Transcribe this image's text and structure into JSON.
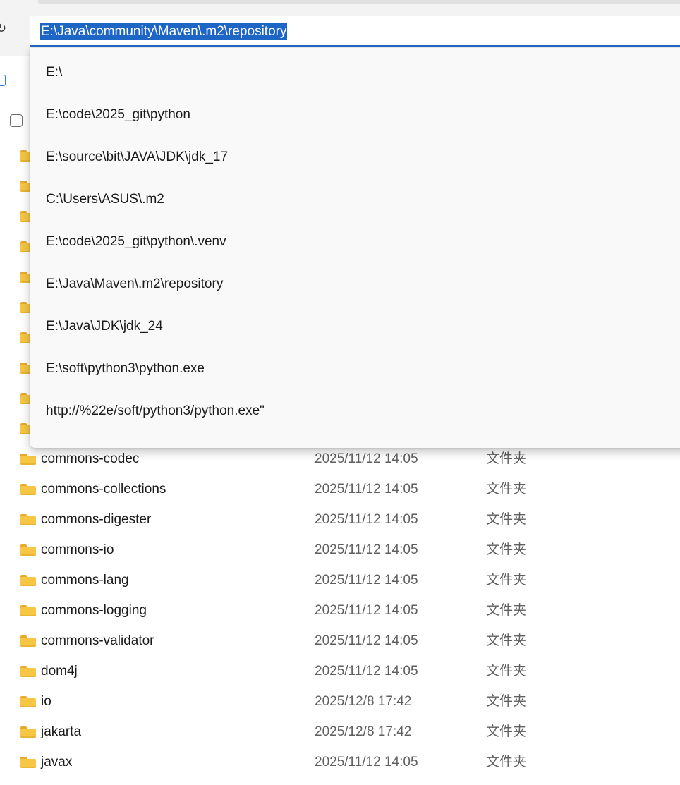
{
  "address_bar": {
    "value": "E:\\Java\\community\\Maven\\.m2\\repository"
  },
  "address_history": [
    "E:\\",
    "E:\\code\\2025_git\\python",
    "E:\\source\\bit\\JAVA\\JDK\\jdk_17",
    "C:\\Users\\ASUS\\.m2",
    "E:\\code\\2025_git\\python\\.venv",
    "E:\\Java\\Maven\\.m2\\repository",
    "E:\\Java\\JDK\\jdk_24",
    "E:\\soft\\python3\\python.exe",
    "http://%22e/soft/python3/python.exe\""
  ],
  "files": [
    {
      "name": "commons-codec",
      "date": "2025/11/12 14:05",
      "type": "文件夹"
    },
    {
      "name": "commons-collections",
      "date": "2025/11/12 14:05",
      "type": "文件夹"
    },
    {
      "name": "commons-digester",
      "date": "2025/11/12 14:05",
      "type": "文件夹"
    },
    {
      "name": "commons-io",
      "date": "2025/11/12 14:05",
      "type": "文件夹"
    },
    {
      "name": "commons-lang",
      "date": "2025/11/12 14:05",
      "type": "文件夹"
    },
    {
      "name": "commons-logging",
      "date": "2025/11/12 14:05",
      "type": "文件夹"
    },
    {
      "name": "commons-validator",
      "date": "2025/11/12 14:05",
      "type": "文件夹"
    },
    {
      "name": "dom4j",
      "date": "2025/11/12 14:05",
      "type": "文件夹"
    },
    {
      "name": "io",
      "date": "2025/12/8 17:42",
      "type": "文件夹"
    },
    {
      "name": "jakarta",
      "date": "2025/12/8 17:42",
      "type": "文件夹"
    },
    {
      "name": "javax",
      "date": "2025/11/12 14:05",
      "type": "文件夹"
    }
  ],
  "icons": {
    "folder": "folder-icon",
    "refresh": "refresh-icon",
    "view": "view-icon"
  },
  "colors": {
    "accent": "#1e66c6",
    "folder": "#f6c644",
    "secondary_text": "#5f5f5f"
  }
}
